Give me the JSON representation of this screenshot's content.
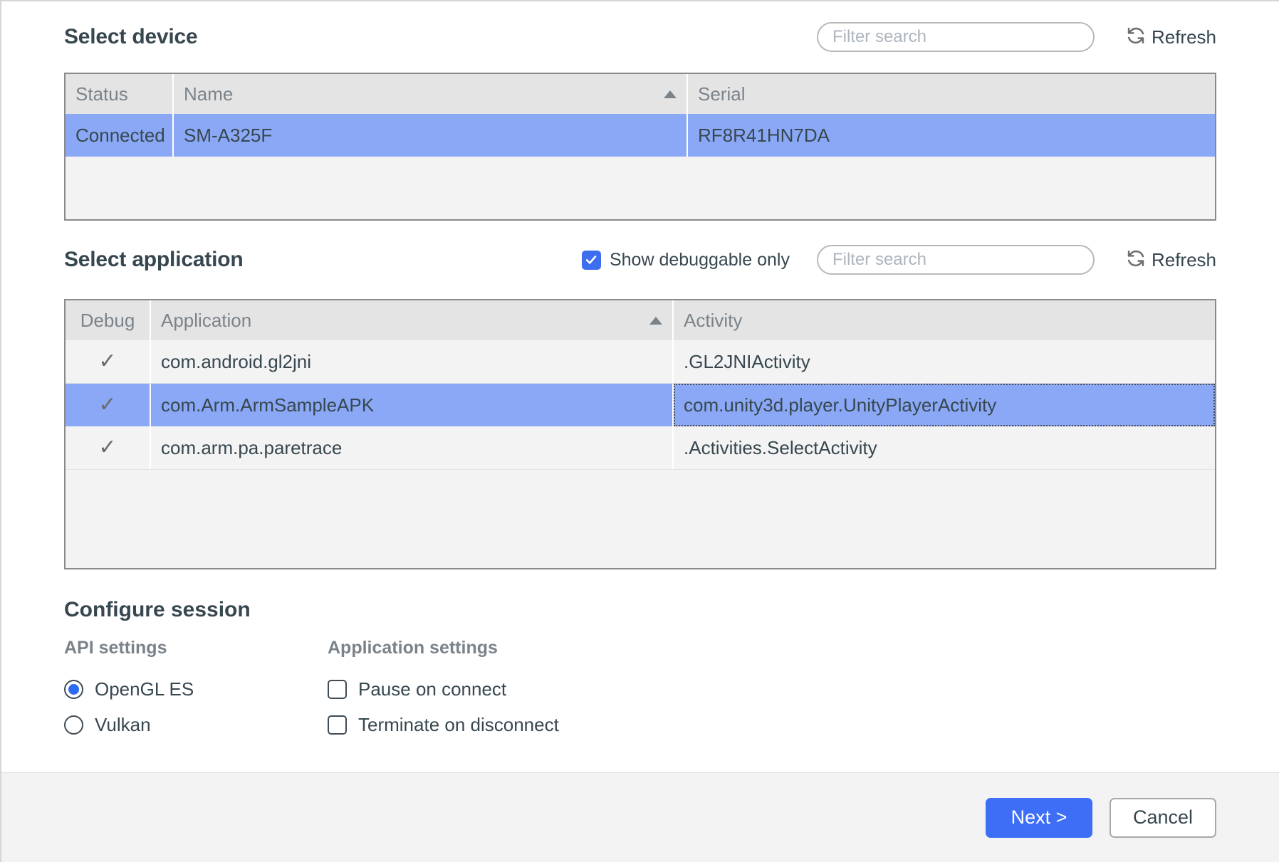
{
  "device_section": {
    "title": "Select device",
    "filter": {
      "placeholder": "Filter search",
      "value": ""
    },
    "refresh": {
      "label": "Refresh",
      "icon": "refresh-icon"
    },
    "columns": [
      "Status",
      "Name",
      "Serial"
    ],
    "sorted_column": "Name",
    "sort_direction": "ascending",
    "rows": [
      {
        "status": "Connected",
        "name": "SM-A325F",
        "serial": "RF8R41HN7DA",
        "selected": true
      }
    ]
  },
  "application_section": {
    "title": "Select application",
    "debuggable_toggle": {
      "label": "Show debuggable only",
      "checked": true
    },
    "filter": {
      "placeholder": "Filter search",
      "value": ""
    },
    "refresh": {
      "label": "Refresh",
      "icon": "refresh-icon"
    },
    "columns": [
      "Debug",
      "Application",
      "Activity"
    ],
    "sorted_column": "Application",
    "sort_direction": "ascending",
    "check_glyph": "✓",
    "rows": [
      {
        "debug": "✓",
        "application": "com.android.gl2jni",
        "activity": ".GL2JNIActivity",
        "selected": false
      },
      {
        "debug": "✓",
        "application": "com.Arm.ArmSampleAPK",
        "activity": "com.unity3d.player.UnityPlayerActivity",
        "selected": true
      },
      {
        "debug": "✓",
        "application": "com.arm.pa.paretrace",
        "activity": ".Activities.SelectActivity",
        "selected": false
      }
    ]
  },
  "configure_section": {
    "title": "Configure session",
    "api_settings": {
      "label": "API settings",
      "options": [
        {
          "label": "OpenGL ES",
          "selected": true
        },
        {
          "label": "Vulkan",
          "selected": false
        }
      ]
    },
    "application_settings": {
      "label": "Application settings",
      "options": [
        {
          "label": "Pause on connect",
          "checked": false
        },
        {
          "label": "Terminate on disconnect",
          "checked": false
        }
      ]
    }
  },
  "footer": {
    "next_label": "Next >",
    "cancel_label": "Cancel"
  },
  "colors": {
    "selection_blue": "#8aa8f5",
    "accent_blue": "#3d6ef5",
    "header_gray": "#e4e4e4",
    "body_gray": "#f3f3f3",
    "text": "#37474f",
    "muted_text": "#7b838a"
  }
}
